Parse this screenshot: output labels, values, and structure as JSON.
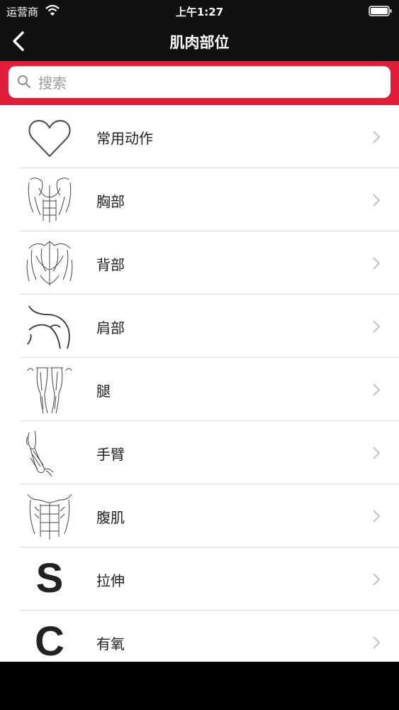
{
  "status": {
    "carrier": "运营商",
    "time": "上午1:27"
  },
  "nav": {
    "title": "肌肉部位"
  },
  "search": {
    "placeholder": "搜索"
  },
  "items": [
    {
      "label": "常用动作",
      "icon": "heart-icon"
    },
    {
      "label": "胸部",
      "icon": "chest-muscle-icon"
    },
    {
      "label": "背部",
      "icon": "back-muscle-icon"
    },
    {
      "label": "肩部",
      "icon": "shoulder-icon"
    },
    {
      "label": "腿",
      "icon": "legs-icon"
    },
    {
      "label": "手臂",
      "icon": "arm-icon"
    },
    {
      "label": "腹肌",
      "icon": "abs-icon"
    },
    {
      "label": "拉伸",
      "icon": "letter-s-icon",
      "letter": "S"
    },
    {
      "label": "有氧",
      "icon": "letter-c-icon",
      "letter": "C"
    }
  ]
}
